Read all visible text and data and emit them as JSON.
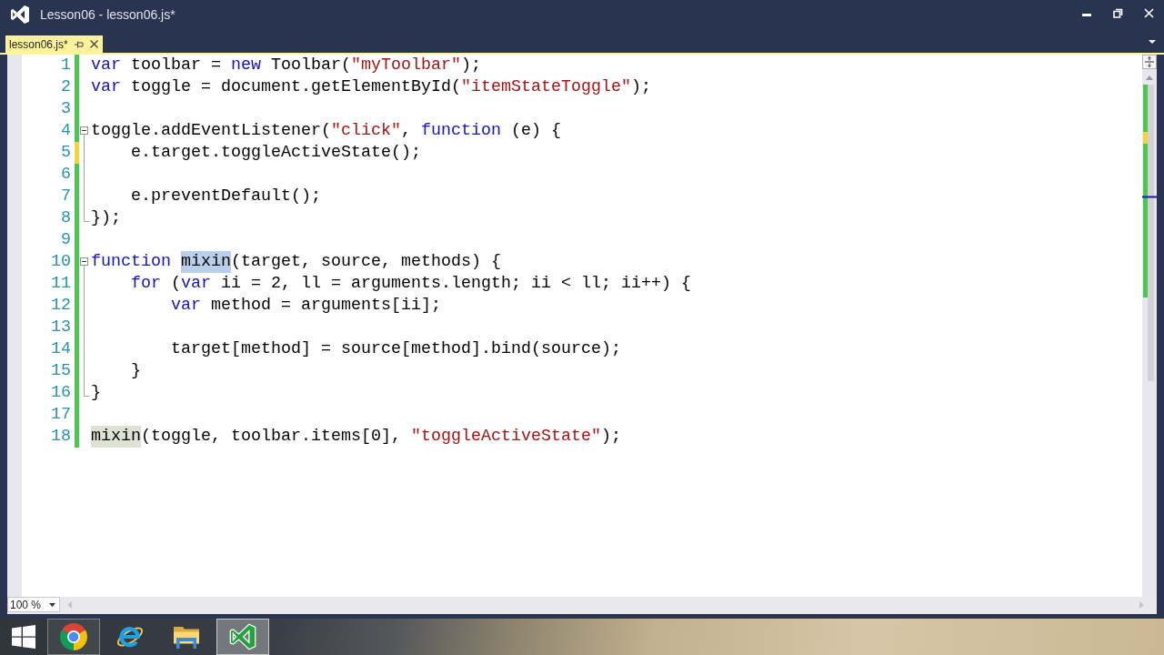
{
  "window": {
    "title": "Lesson06 - lesson06.js*"
  },
  "tabs": [
    {
      "label": "lesson06.js*",
      "selected": true
    }
  ],
  "editor": {
    "lines": [
      {
        "number": "1",
        "unsaved": false,
        "tokens": [
          {
            "text": "var",
            "kind": "keyword"
          },
          {
            "text": " toolbar = ",
            "kind": "plain"
          },
          {
            "text": "new",
            "kind": "keyword"
          },
          {
            "text": " Toolbar(",
            "kind": "plain"
          },
          {
            "text": "\"myToolbar\"",
            "kind": "string"
          },
          {
            "text": ");",
            "kind": "plain"
          }
        ]
      },
      {
        "number": "2",
        "unsaved": false,
        "tokens": [
          {
            "text": "var",
            "kind": "keyword"
          },
          {
            "text": " toggle = document.getElementById(",
            "kind": "plain"
          },
          {
            "text": "\"itemStateToggle\"",
            "kind": "string"
          },
          {
            "text": ");",
            "kind": "plain"
          }
        ]
      },
      {
        "number": "3",
        "unsaved": false
      },
      {
        "number": "4",
        "unsaved": false,
        "expanded": true,
        "tokens": [
          {
            "text": "toggle.addEventListener(",
            "kind": "plain"
          },
          {
            "text": "\"click\"",
            "kind": "string"
          },
          {
            "text": ", ",
            "kind": "plain"
          },
          {
            "text": "function",
            "kind": "keyword"
          },
          {
            "text": " (e) {",
            "kind": "plain"
          }
        ],
        "children": [
          {
            "number": "5",
            "unsaved": true,
            "tokens": [
              {
                "text": "    e.target.toggleActiveState();",
                "kind": "plain"
              }
            ]
          },
          {
            "number": "6",
            "unsaved": false
          },
          {
            "number": "7",
            "unsaved": false,
            "tokens": [
              {
                "text": "    e.preventDefault();",
                "kind": "plain"
              }
            ]
          },
          {
            "number": "8",
            "unsaved": false,
            "tokens": [
              {
                "text": "});",
                "kind": "plain"
              }
            ]
          }
        ]
      },
      {
        "number": "9",
        "unsaved": false
      },
      {
        "number": "10",
        "unsaved": false,
        "expanded": true,
        "tokens": [
          {
            "text": "function ",
            "kind": "keyword"
          },
          {
            "text": "mixin",
            "kind": "selection"
          },
          {
            "text": "(target, source, methods) {",
            "kind": "plain"
          }
        ],
        "children": [
          {
            "number": "11",
            "unsaved": false,
            "tokens": [
              {
                "text": "    for",
                "kind": "keyword"
              },
              {
                "text": " (",
                "kind": "plain"
              },
              {
                "text": "var",
                "kind": "keyword"
              },
              {
                "text": " ii = 2, ll = arguments.length; ii < ll; ii++) {",
                "kind": "plain"
              }
            ]
          },
          {
            "number": "12",
            "unsaved": false,
            "tokens": [
              {
                "text": "        var",
                "kind": "keyword"
              },
              {
                "text": " method = arguments[ii];",
                "kind": "plain"
              }
            ]
          },
          {
            "number": "13",
            "unsaved": false
          },
          {
            "number": "14",
            "unsaved": false,
            "tokens": [
              {
                "text": "        target[method] = source[method].bind(source);",
                "kind": "plain"
              }
            ]
          },
          {
            "number": "15",
            "unsaved": false,
            "tokens": [
              {
                "text": "    }",
                "kind": "plain"
              }
            ]
          },
          {
            "number": "16",
            "unsaved": false,
            "tokens": [
              {
                "text": "}",
                "kind": "plain"
              }
            ]
          }
        ]
      },
      {
        "number": "17",
        "unsaved": false
      },
      {
        "number": "18",
        "unsaved": false,
        "tokens": [
          {
            "text": "mixin",
            "kind": "reference"
          },
          {
            "text": "(toggle, toolbar.items[0], ",
            "kind": "plain"
          },
          {
            "text": "\"toggleActiveState\"",
            "kind": "string"
          },
          {
            "text": ");",
            "kind": "plain"
          }
        ]
      }
    ]
  },
  "zoom": {
    "value": "100 %"
  },
  "taskbar": {
    "items": [
      {
        "kind": "chrome",
        "running": true,
        "selected": false
      },
      {
        "kind": "ie",
        "running": false,
        "selected": false
      },
      {
        "kind": "files",
        "running": false,
        "selected": false
      },
      {
        "kind": "studio",
        "running": true,
        "selected": true
      }
    ]
  }
}
